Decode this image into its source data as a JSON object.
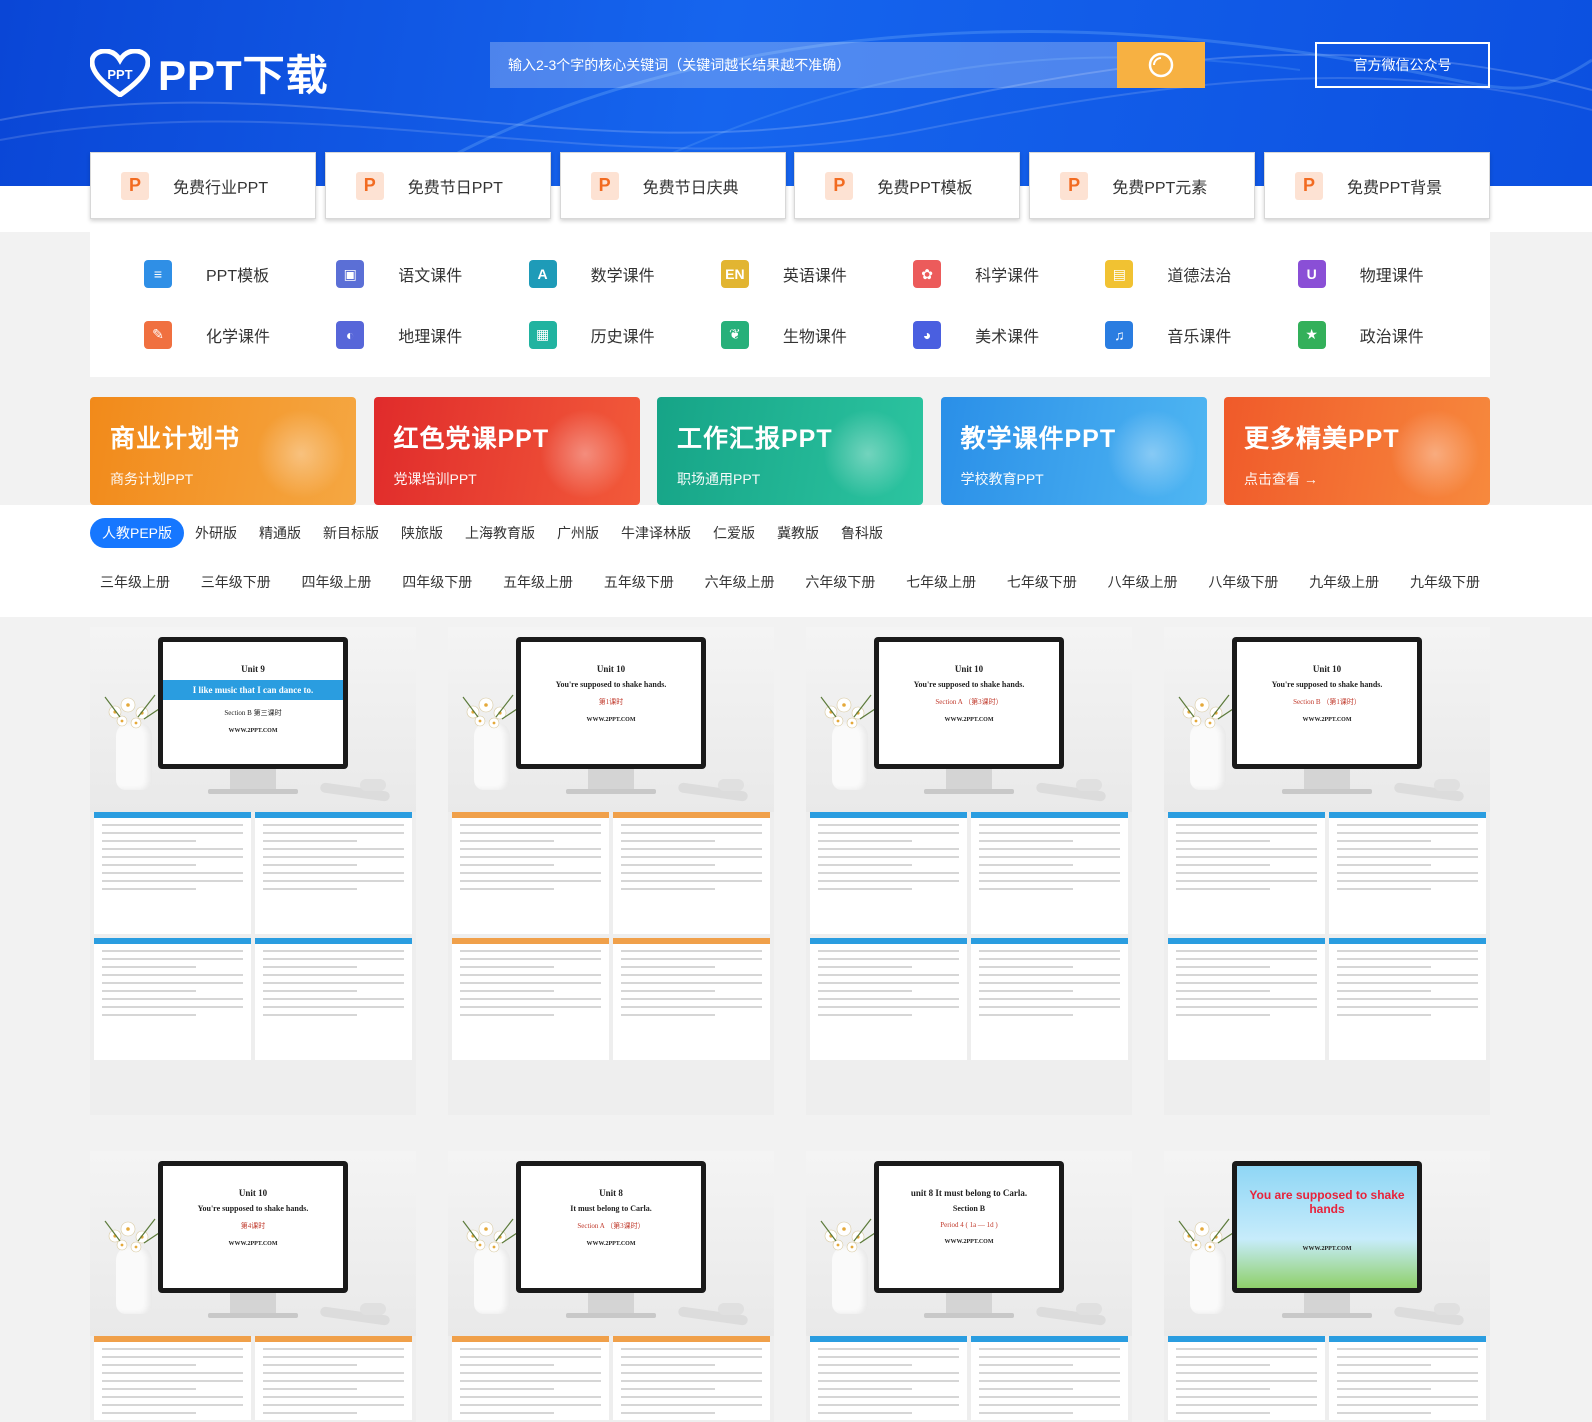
{
  "header": {
    "logo_text": "PPT下载",
    "logo_mark_text": "PPT",
    "search_placeholder": "输入2-3个字的核心关键词（关键词越长结果越不准确）",
    "wechat_label": "官方微信公众号"
  },
  "categories": [
    {
      "icon": "P",
      "label": "免费行业PPT"
    },
    {
      "icon": "P",
      "label": "免费节日PPT"
    },
    {
      "icon": "P",
      "label": "免费节日庆典"
    },
    {
      "icon": "P",
      "label": "免费PPT模板"
    },
    {
      "icon": "P",
      "label": "免费PPT元素"
    },
    {
      "icon": "P",
      "label": "免费PPT背景"
    }
  ],
  "subjects": [
    {
      "label": "PPT模板",
      "color": "#2f8fe6",
      "glyph": "≡"
    },
    {
      "label": "语文课件",
      "color": "#5b6fd6",
      "glyph": "▣"
    },
    {
      "label": "数学课件",
      "color": "#1e9bb8",
      "glyph": "A"
    },
    {
      "label": "英语课件",
      "color": "#e2b531",
      "glyph": "EN"
    },
    {
      "label": "科学课件",
      "color": "#ec5b5b",
      "glyph": "✿"
    },
    {
      "label": "道德法治",
      "color": "#f1c232",
      "glyph": "▤"
    },
    {
      "label": "物理课件",
      "color": "#8a4fd6",
      "glyph": "U"
    },
    {
      "label": "化学课件",
      "color": "#f07040",
      "glyph": "✎"
    },
    {
      "label": "地理课件",
      "color": "#5766d9",
      "glyph": "◐"
    },
    {
      "label": "历史课件",
      "color": "#21b3a0",
      "glyph": "▦"
    },
    {
      "label": "生物课件",
      "color": "#27b07a",
      "glyph": "❦"
    },
    {
      "label": "美术课件",
      "color": "#4a5fe0",
      "glyph": "◕"
    },
    {
      "label": "音乐课件",
      "color": "#2a7de1",
      "glyph": "♫"
    },
    {
      "label": "政治课件",
      "color": "#33b05a",
      "glyph": "★"
    }
  ],
  "banners": [
    {
      "title": "商业计划书",
      "sub": "商务计划PPT",
      "color1": "#f28a1a",
      "color2": "#f5a742"
    },
    {
      "title": "红色党课PPT",
      "sub": "党课培训PPT",
      "color1": "#e02b2b",
      "color2": "#f25a3a"
    },
    {
      "title": "工作汇报PPT",
      "sub": "职场通用PPT",
      "color1": "#16a487",
      "color2": "#2cc4a0"
    },
    {
      "title": "教学课件PPT",
      "sub": "学校教育PPT",
      "color1": "#2a8fe8",
      "color2": "#4fb6f2"
    },
    {
      "title": "更多精美PPT",
      "sub": "点击查看 →",
      "color1": "#f05a2a",
      "color2": "#f7893d"
    }
  ],
  "editions": [
    "人教PEP版",
    "外研版",
    "精通版",
    "新目标版",
    "陕旅版",
    "上海教育版",
    "广州版",
    "牛津译林版",
    "仁爱版",
    "冀教版",
    "鲁科版"
  ],
  "grades": [
    "三年级上册",
    "三年级下册",
    "四年级上册",
    "四年级下册",
    "五年级上册",
    "五年级下册",
    "六年级上册",
    "六年级下册",
    "七年级上册",
    "七年级下册",
    "八年级上册",
    "八年级下册",
    "九年级上册",
    "九年级下册"
  ],
  "thumbs": [
    {
      "unit": "Unit 9",
      "title": "I like music that I can dance to.",
      "section": "Section B 第三课时",
      "url": "WWW.2PPT.COM",
      "style": "bar"
    },
    {
      "unit": "Unit 10",
      "title": "You're supposed to shake hands.",
      "section": "第1课时",
      "url": "WWW.2PPT.COM",
      "style": "plain"
    },
    {
      "unit": "Unit 10",
      "title": "You're supposed to shake hands.",
      "section": "Section A （第3课时）",
      "url": "WWW.2PPT.COM",
      "style": "plain"
    },
    {
      "unit": "Unit 10",
      "title": "You're supposed to shake hands.",
      "section": "Section B （第1课时）",
      "url": "WWW.2PPT.COM",
      "style": "plain"
    },
    {
      "unit": "Unit 10",
      "title": "You're supposed to shake hands.",
      "section": "第4课时",
      "url": "WWW.2PPT.COM",
      "style": "plain"
    },
    {
      "unit": "Unit 8",
      "title": "It must belong to Carla.",
      "section": "Section A （第3课时）",
      "url": "WWW.2PPT.COM",
      "style": "plain"
    },
    {
      "unit": "unit 8  It must belong to Carla.",
      "title": "Section B",
      "section": "Period 4 ( 1a — 1d )",
      "url": "WWW.2PPT.COM",
      "style": "plain"
    },
    {
      "unit": "",
      "title": "You are supposed to shake hands",
      "section": "",
      "url": "WWW.2PPT.COM",
      "style": "sky"
    }
  ]
}
